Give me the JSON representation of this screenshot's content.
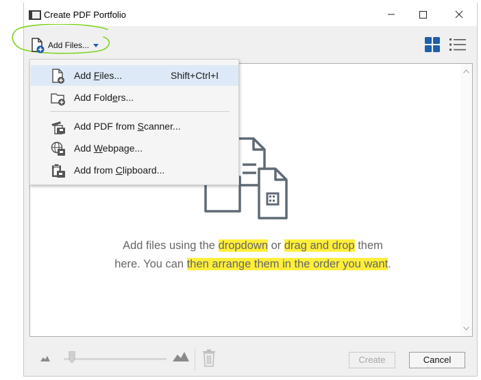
{
  "window": {
    "title": "Create PDF Portfolio",
    "controls": [
      "minimize",
      "maximize",
      "close"
    ]
  },
  "toolbar": {
    "add_files_label": "Add Files...",
    "view_modes": [
      "grid-view-icon",
      "list-view-icon"
    ]
  },
  "menu": {
    "items": [
      {
        "label": "Add Files...",
        "underline_char": "F",
        "shortcut": "Shift+Ctrl+I",
        "icon": "add-file-icon",
        "active": true
      },
      {
        "label": "Add Folders...",
        "underline_char": "e",
        "shortcut": "",
        "icon": "add-folder-icon",
        "active": false
      },
      {
        "label": "Add PDF from Scanner...",
        "underline_char": "S",
        "shortcut": "",
        "icon": "scanner-icon",
        "active": false
      },
      {
        "label": "Add Webpage...",
        "underline_char": "W",
        "shortcut": "",
        "icon": "webpage-icon",
        "active": false
      },
      {
        "label": "Add from Clipboard...",
        "underline_char": "C",
        "shortcut": "",
        "icon": "clipboard-icon",
        "active": false
      }
    ]
  },
  "empty_state": {
    "line1_a": "Add files using the ",
    "line1_hl1": "dropdown",
    "line1_b": " or ",
    "line1_hl2": "drag and drop",
    "line1_c": " them",
    "line2_a": "here. You can ",
    "line2_hl": "then arrange them in the order you want",
    "line2_b": "."
  },
  "footer": {
    "create_label": "Create",
    "cancel_label": "Cancel",
    "thumbnail_size": 0.05
  },
  "colors": {
    "accent_blue": "#1f5fa8",
    "highlight": "#ffef3a",
    "annotation_green": "#7ed321",
    "menu_active": "#dde9f6"
  }
}
